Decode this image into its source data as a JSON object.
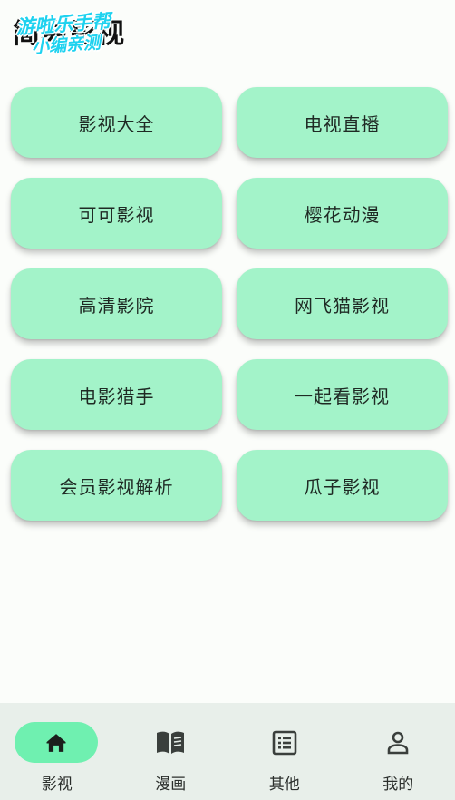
{
  "header": {
    "title": "简易影视",
    "watermark_line1": "游啦乐手帮",
    "watermark_line2": "小编亲测"
  },
  "sites": [
    {
      "label": "影视大全"
    },
    {
      "label": "电视直播"
    },
    {
      "label": "可可影视"
    },
    {
      "label": "樱花动漫"
    },
    {
      "label": "高清影院"
    },
    {
      "label": "网飞猫影视"
    },
    {
      "label": "电影猎手"
    },
    {
      "label": "一起看影视"
    },
    {
      "label": "会员影视解析"
    },
    {
      "label": "瓜子影视"
    }
  ],
  "nav": {
    "items": [
      {
        "label": "影视",
        "icon": "home-icon",
        "active": true
      },
      {
        "label": "漫画",
        "icon": "book-icon",
        "active": false
      },
      {
        "label": "其他",
        "icon": "list-icon",
        "active": false
      },
      {
        "label": "我的",
        "icon": "person-icon",
        "active": false
      }
    ]
  },
  "colors": {
    "card": "#a3f3c9",
    "nav_active_pill": "#6ff0b0",
    "nav_background": "#e8efea",
    "watermark": "#1ed2ef"
  }
}
